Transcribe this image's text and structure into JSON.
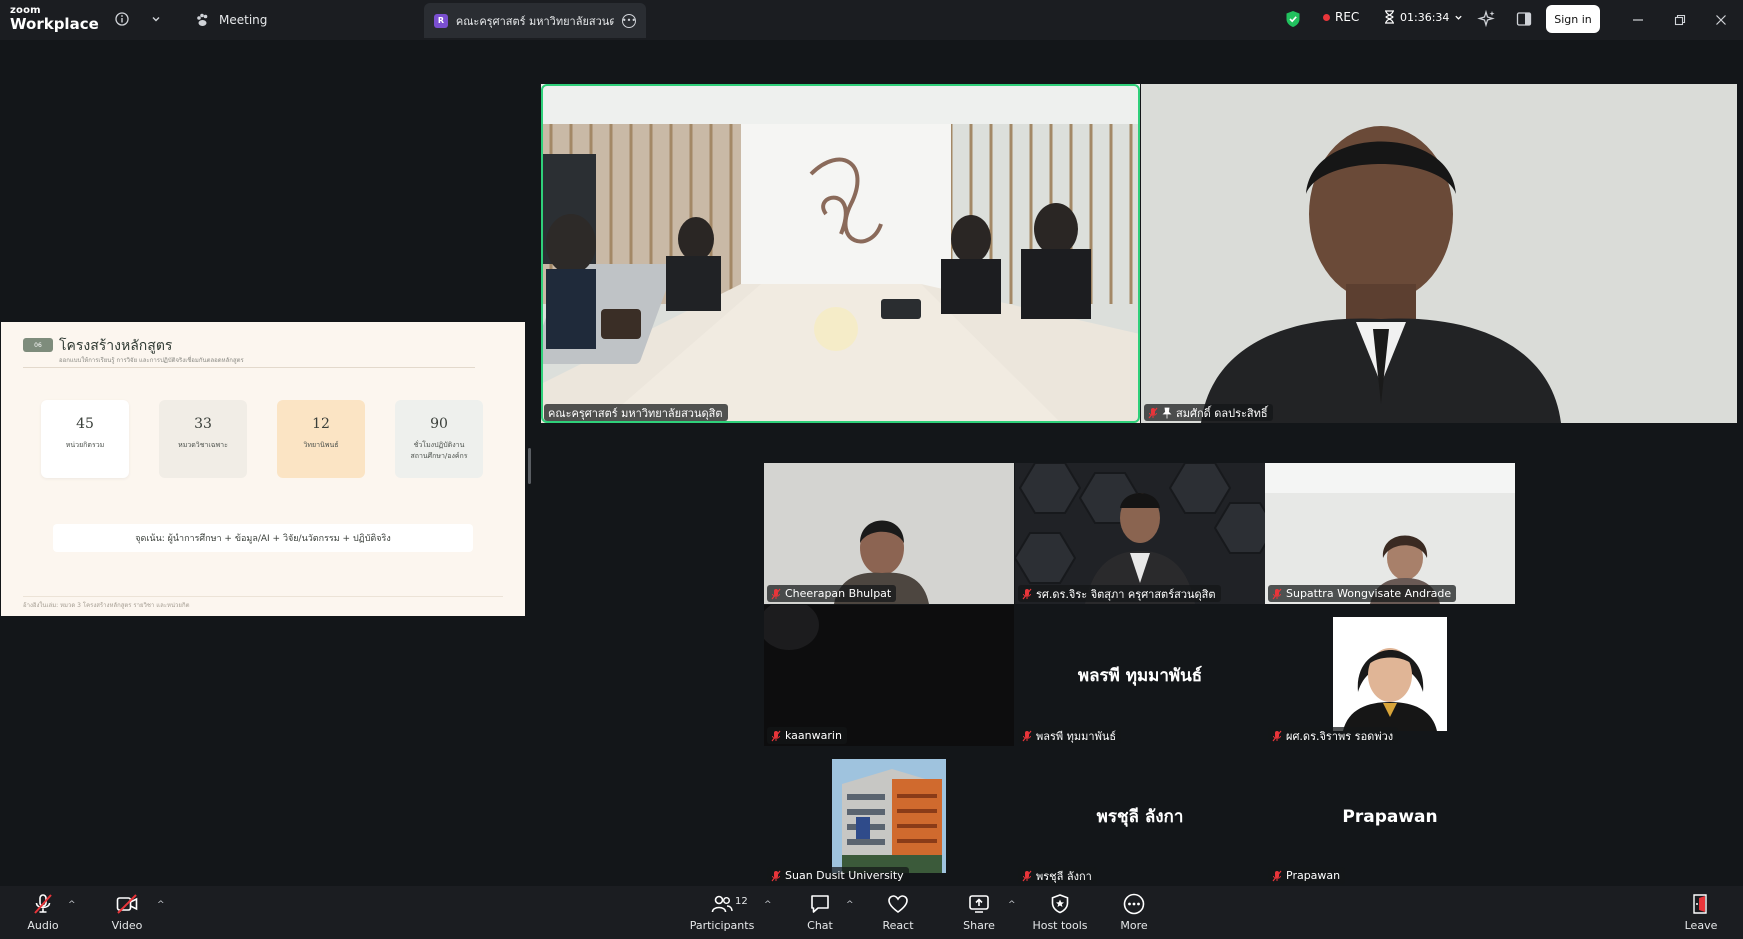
{
  "titlebar": {
    "logo_line1": "zoom",
    "logo_line2": "Workplace",
    "meeting_label": "Meeting",
    "tab_badge": "R",
    "tab_title": "คณะครุศาสตร์ มหาวิทยาลัยสวนดุสิต's s",
    "rec_label": "REC",
    "timer": "01:36:34",
    "signin_label": "Sign in"
  },
  "slide": {
    "badge": "06",
    "title": "โครงสร้างหลักสูตร",
    "subtitle": "ออกแบบให้การเรียนรู้ การวิจัย และการปฏิบัติจริงเชื่อมกันตลอดหลักสูตร",
    "stats": [
      {
        "value": "45",
        "label": "หน่วยกิตรวม",
        "bg": "#ffffff"
      },
      {
        "value": "33",
        "label": "หมวดวิชาเฉพาะ",
        "bg": "#f1ede6"
      },
      {
        "value": "12",
        "label": "วิทยานิพนธ์",
        "bg": "#fbe4c4"
      },
      {
        "value": "90",
        "label1": "ชั่วโมงปฏิบัติงาน",
        "label2": "สถานศึกษา/องค์กร",
        "bg": "#eef0ed"
      }
    ],
    "focus": "จุดเน้น: ผู้นำการศึกษา + ข้อมูล/AI + วิจัย/นวัตกรรม + ปฏิบัติจริง",
    "footer": "อ้างอิงในเล่ม: หมวด 3 โครงสร้างหลักสูตร รายวิชา และหน่วยกิต"
  },
  "participants": {
    "room": "คณะครุศาสตร์ มหาวิทยาลัยสวนดุสิต",
    "somsak": "สมศักดิ์ ดลประสิทธิ์",
    "cheerapan": "Cheerapan Bhulpat",
    "jira": "รศ.ดร.จิระ จิตสุภา ครุศาสตร์สวนดุสิต",
    "supattra": "Supattra Wongvisate Andrade",
    "kaanwarin": "kaanwarin",
    "ponpee_center": "พลรพี ทุมมาพันธ์",
    "ponpee_tag": "พลรพี ทุมมาพันธ์",
    "jiraporn": "ผศ.ดร.จิราพร รอดพ่วง",
    "suandusit": "Suan Dusit University",
    "pornchuli_center": "พรชุลี ลังกา",
    "pornchuli_tag": "พรชุลี ลังกา",
    "prapawan_center": "Prapawan",
    "prapawan_tag": "Prapawan"
  },
  "toolbar": {
    "audio": "Audio",
    "video": "Video",
    "participants_label": "Participants",
    "participants_count": "12",
    "chat": "Chat",
    "react": "React",
    "share": "Share",
    "host_tools": "Host tools",
    "more": "More",
    "leave": "Leave"
  }
}
